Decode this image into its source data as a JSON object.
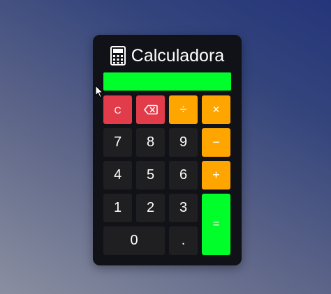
{
  "app": {
    "title": "Calculadora",
    "title_icon": "calculator-icon"
  },
  "display": {
    "value": ""
  },
  "colors": {
    "display_bg": "#00ff2a",
    "clear_bg": "#e23b4a",
    "backspace_bg": "#e23b4a",
    "operator_bg": "#ffa500",
    "equals_bg": "#00ff2a",
    "number_bg": "#1f1f22",
    "panel_bg": "#111217"
  },
  "keys": {
    "clear": "C",
    "backspace_icon": "backspace-icon",
    "divide": "÷",
    "multiply": "×",
    "subtract": "−",
    "add": "+",
    "equals": "=",
    "seven": "7",
    "eight": "8",
    "nine": "9",
    "four": "4",
    "five": "5",
    "six": "6",
    "one": "1",
    "two": "2",
    "three": "3",
    "zero": "0",
    "decimal": "."
  },
  "cursor_icon": "mouse-pointer-icon"
}
